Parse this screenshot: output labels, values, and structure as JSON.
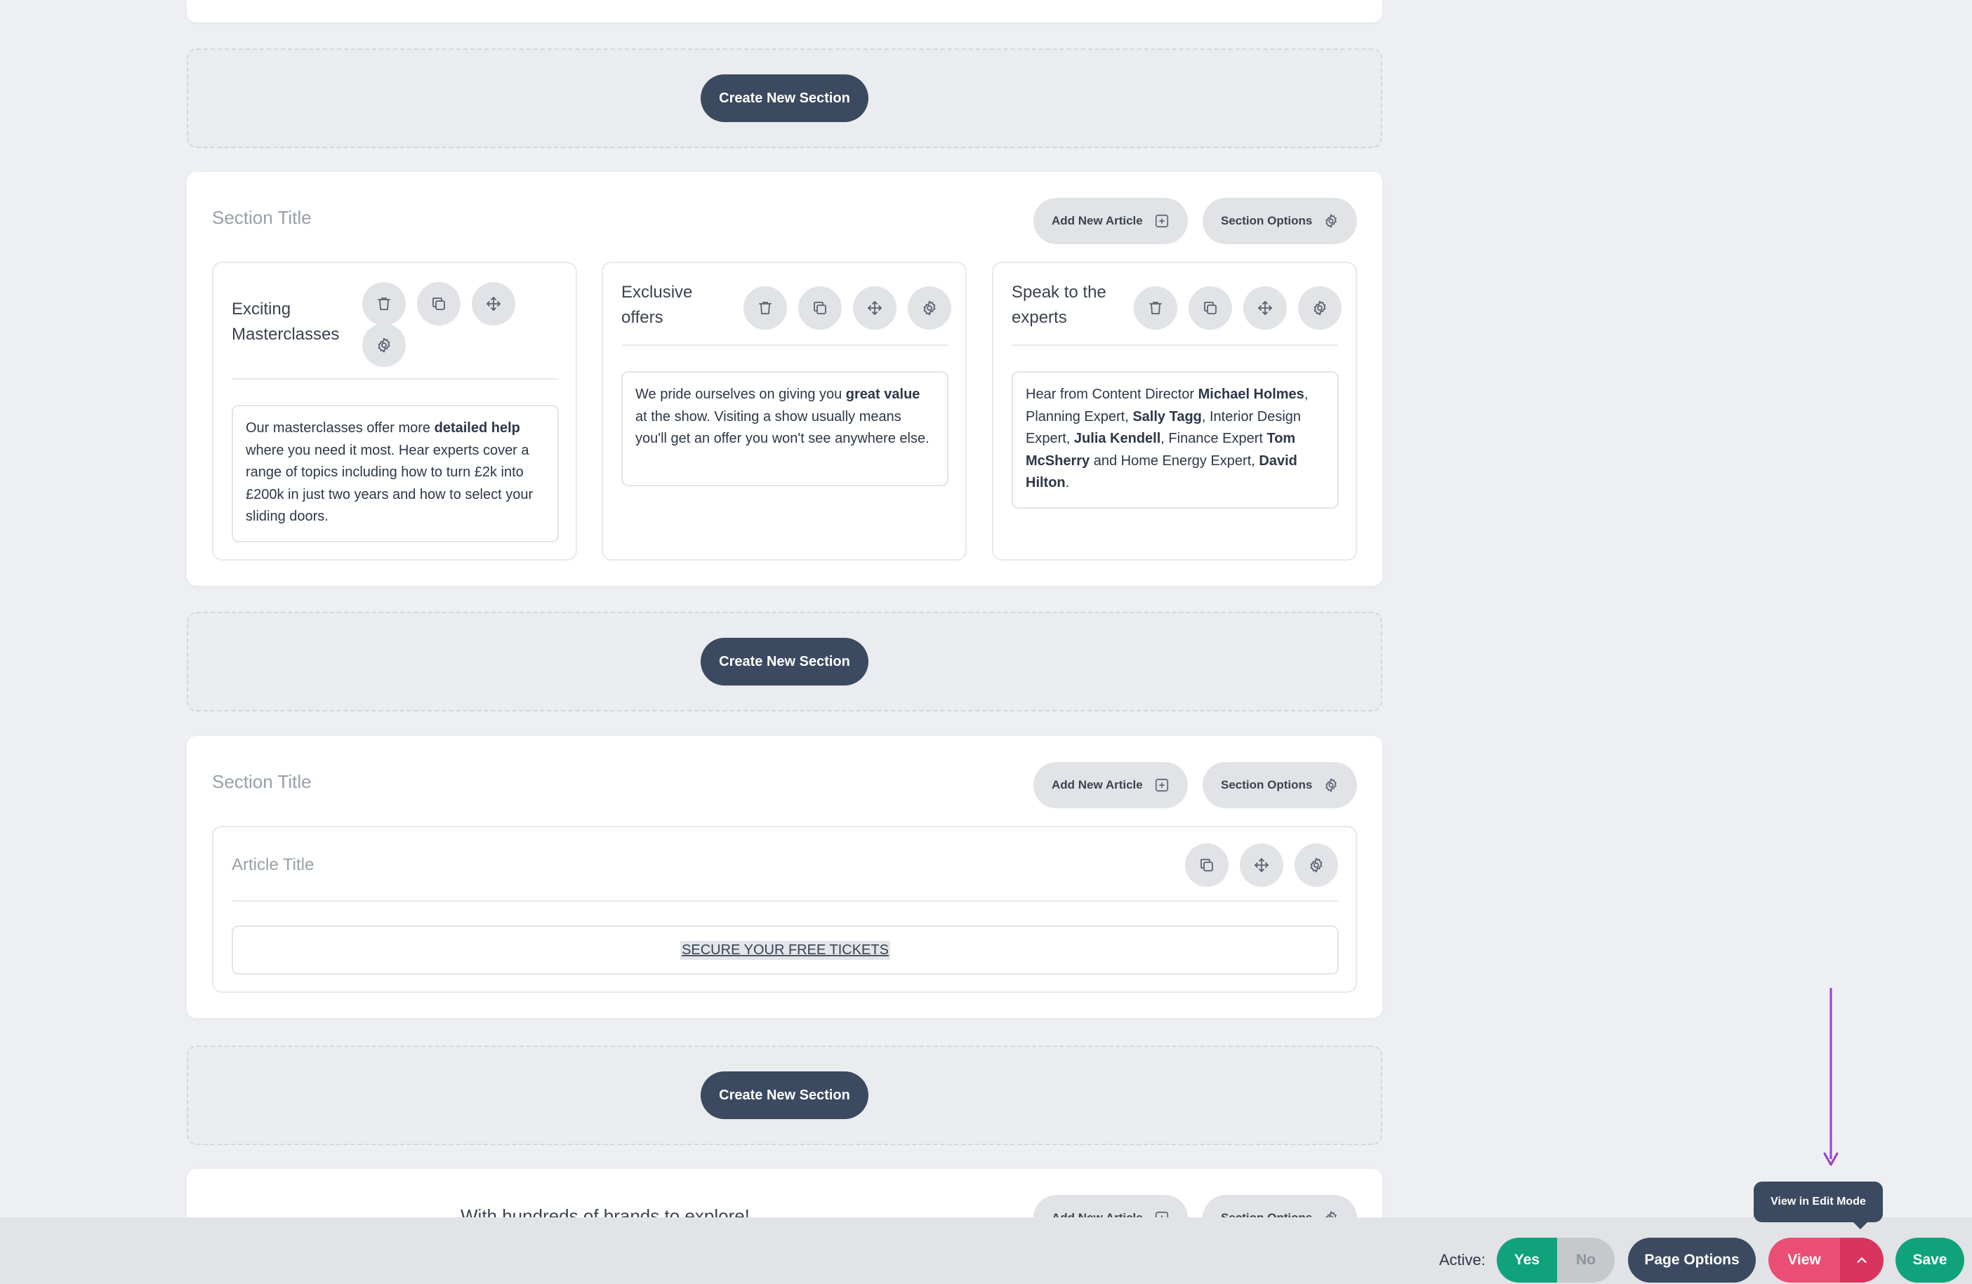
{
  "create_section_label": "Create New Section",
  "sections": [
    {
      "title": "Section Title",
      "add_article_label": "Add New Article",
      "section_options_label": "Section Options",
      "articles": [
        {
          "title": "Exciting Masterclasses",
          "text_parts": [
            "Our masterclasses offer more ",
            "detailed help",
            " where you need it most. Hear experts cover a range of topics including how to turn £2k into £200k in just two years and how to select your sliding doors."
          ]
        },
        {
          "title": "Exclusive offers",
          "text_parts": [
            "We pride ourselves on giving you ",
            "great value",
            " at the show. Visiting a show usually means you'll get an offer you won't see anywhere else."
          ]
        },
        {
          "title": "Speak to the experts",
          "text_parts": [
            "Hear from Content Director ",
            "Michael Holmes",
            ", Planning Expert, ",
            "Sally Tagg",
            ", Interior Design Expert, ",
            "Julia Kendell",
            ", Finance Expert ",
            "Tom McSherry",
            " and Home Energy Expert, ",
            "David Hilton",
            "."
          ]
        }
      ]
    },
    {
      "title": "Section Title",
      "add_article_label": "Add New Article",
      "section_options_label": "Section Options",
      "article_title": "Article Title",
      "ticket_text": "SECURE YOUR FREE TICKETS"
    },
    {
      "title": "With hundreds of brands to explore!",
      "add_article_label": "Add New Article",
      "section_options_label": "Section Options"
    }
  ],
  "bottom_bar": {
    "active_label": "Active:",
    "yes_label": "Yes",
    "no_label": "No",
    "page_options_label": "Page Options",
    "view_label": "View",
    "save_label": "Save",
    "tooltip": "View in Edit Mode"
  },
  "colors": {
    "primary_dark": "#3b4a60",
    "green": "#10a37b",
    "pink": "#ea4e74",
    "annotation_arrow": "#9b3fc8"
  },
  "icons": [
    "trash-icon",
    "copy-icon",
    "move-icon",
    "gear-icon",
    "plus-square-icon",
    "chevron-up-icon"
  ]
}
